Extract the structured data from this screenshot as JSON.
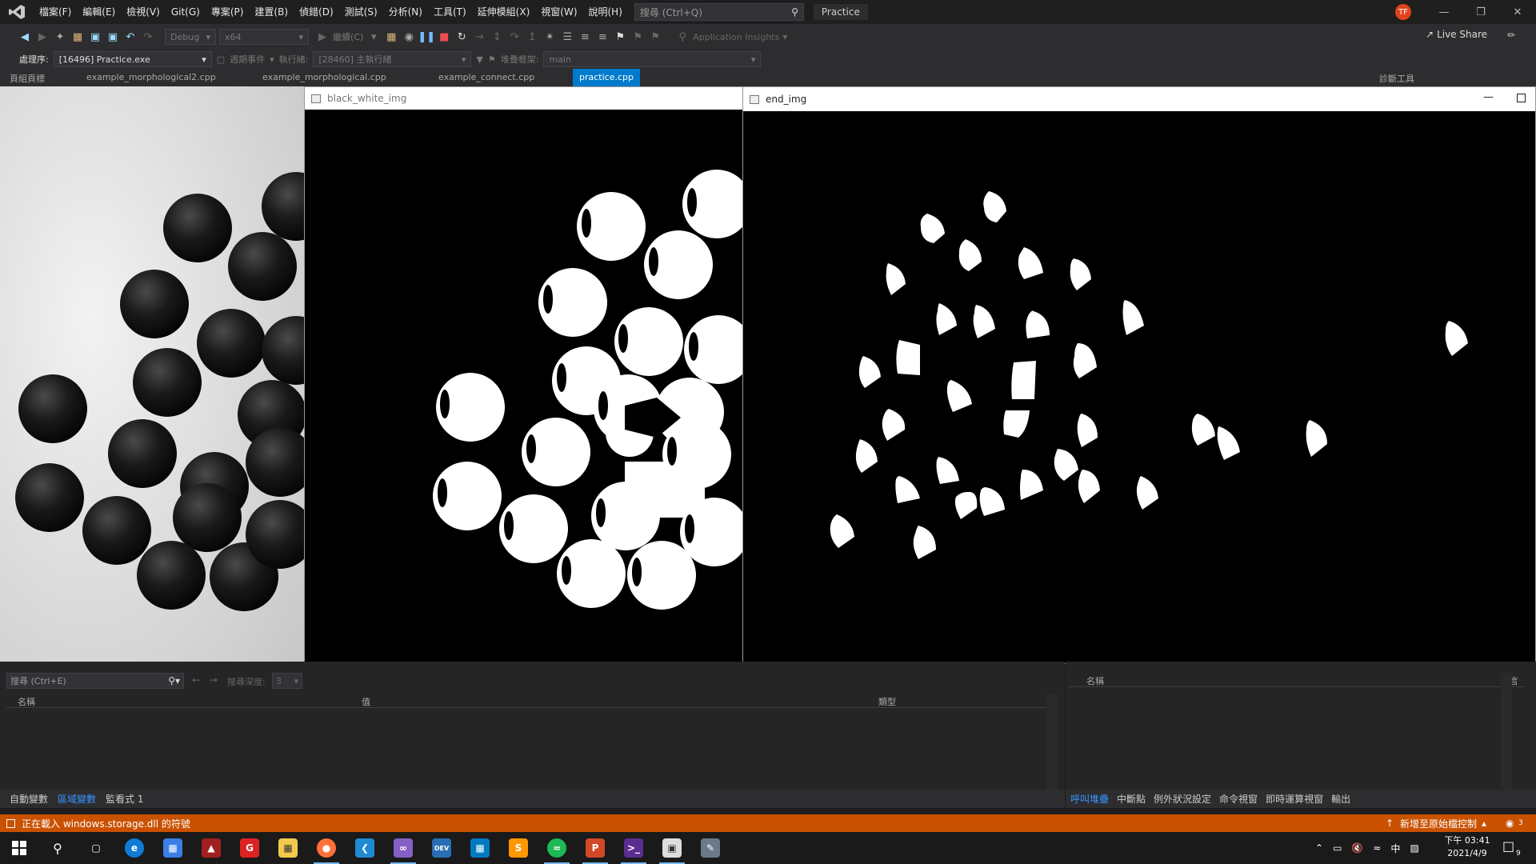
{
  "menubar": {
    "items": [
      "檔案(F)",
      "編輯(E)",
      "檢視(V)",
      "Git(G)",
      "專案(P)",
      "建置(B)",
      "偵錯(D)",
      "測試(S)",
      "分析(N)",
      "工具(T)",
      "延伸模組(X)",
      "視窗(W)",
      "說明(H)"
    ],
    "search_placeholder": "搜尋 (Ctrl+Q)",
    "project": "Practice",
    "avatar": "TF",
    "live_share": "Live Share"
  },
  "toolbar": {
    "config": "Debug",
    "platform": "x64",
    "continue_label": "繼續(C)",
    "app_insights": "Application Insights"
  },
  "toolbar2": {
    "process_label": "處理序:",
    "process_value": "[16496] Practice.exe",
    "lifecycle": "週期事件",
    "thread_label": "執行緒:",
    "thread_value": "[28460] 主執行緒",
    "stack_label": "堆疊框架:",
    "stack_value": "main"
  },
  "doc_tabs": [
    "頁組頁標",
    "example_morphological2.cpp",
    "example_morphological.cpp",
    "example_connect.cpp",
    "practice.cpp",
    "診斷工具"
  ],
  "windows": {
    "bw_title": "black_white_img",
    "end_title": "end_img"
  },
  "locals_panel": {
    "search_placeholder": "搜尋 (Ctrl+E)",
    "depth_label": "搜尋深度:",
    "depth_value": "3",
    "col_name": "名稱",
    "col_value": "值",
    "col_type": "類型",
    "tabs": [
      "自動變數",
      "區域變數",
      "監看式 1"
    ]
  },
  "callstack_panel": {
    "col_name": "名稱",
    "col_lang": "語言",
    "tabs": [
      "呼叫堆疊",
      "中斷點",
      "例外狀況設定",
      "命令視窗",
      "即時運算視窗",
      "輸出"
    ]
  },
  "status": {
    "message": "正在載入 windows.storage.dll 的符號",
    "right": "新增至原始檔控制",
    "badge": "3"
  },
  "taskbar": {
    "time": "下午 03:41",
    "date": "2021/4/9",
    "ime": "中",
    "notif": "9"
  },
  "colors": {
    "status_orange": "#ca5100",
    "accent_blue": "#007acc"
  }
}
